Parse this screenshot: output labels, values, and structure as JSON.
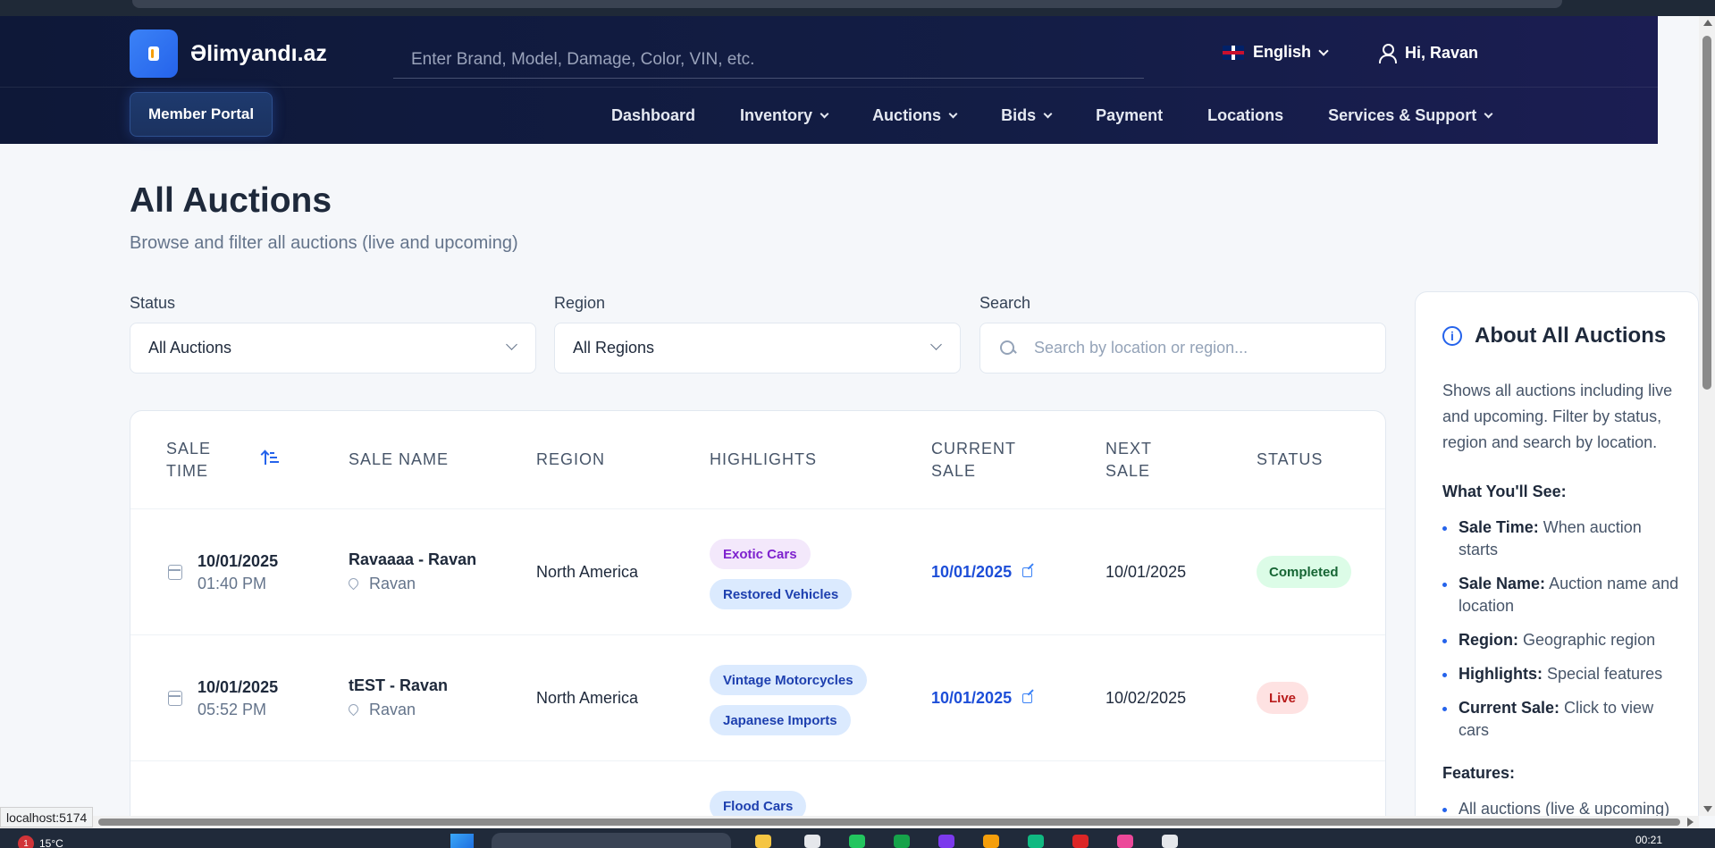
{
  "header": {
    "brand": "Əlimyandı.az",
    "search_placeholder": "Enter Brand, Model, Damage, Color, VIN, etc.",
    "language": "English",
    "greeting": "Hi, Ravan",
    "member_portal": "Member Portal"
  },
  "nav": [
    {
      "label": "Dashboard",
      "has_dropdown": false
    },
    {
      "label": "Inventory",
      "has_dropdown": true
    },
    {
      "label": "Auctions",
      "has_dropdown": true
    },
    {
      "label": "Bids",
      "has_dropdown": true
    },
    {
      "label": "Payment",
      "has_dropdown": false
    },
    {
      "label": "Locations",
      "has_dropdown": false
    },
    {
      "label": "Services & Support",
      "has_dropdown": true
    }
  ],
  "page": {
    "title": "All Auctions",
    "subtitle": "Browse and filter all auctions (live and upcoming)"
  },
  "filters": {
    "status_label": "Status",
    "status_value": "All Auctions",
    "region_label": "Region",
    "region_value": "All Regions",
    "search_label": "Search",
    "search_placeholder": "Search by location or region..."
  },
  "table": {
    "headers": {
      "sale_time": "SALE TIME",
      "sale_name": "SALE NAME",
      "region": "REGION",
      "highlights": "HIGHLIGHTS",
      "current_sale": "CURRENT SALE",
      "next_sale": "NEXT SALE",
      "status": "STATUS"
    },
    "rows": [
      {
        "date": "10/01/2025",
        "time": "01:40 PM",
        "name": "Ravaaaa - Ravan",
        "location": "Ravan",
        "region": "North America",
        "highlights": [
          "Exotic Cars",
          "Restored Vehicles"
        ],
        "current_sale": "10/01/2025",
        "next_sale": "10/01/2025",
        "status": "Completed"
      },
      {
        "date": "10/01/2025",
        "time": "05:52 PM",
        "name": "tEST - Ravan",
        "location": "Ravan",
        "region": "North America",
        "highlights": [
          "Vintage Motorcycles",
          "Japanese Imports"
        ],
        "current_sale": "10/01/2025",
        "next_sale": "10/02/2025",
        "status": "Live"
      },
      {
        "highlights": [
          "Flood Cars"
        ]
      }
    ]
  },
  "info": {
    "title": "About All Auctions",
    "description": "Shows all auctions including live and upcoming. Filter by status, region and search by location.",
    "see_heading": "What You'll See:",
    "items": [
      {
        "term": "Sale Time:",
        "desc": "When auction starts"
      },
      {
        "term": "Sale Name:",
        "desc": "Auction name and location"
      },
      {
        "term": "Region:",
        "desc": "Geographic region"
      },
      {
        "term": "Highlights:",
        "desc": "Special features"
      },
      {
        "term": "Current Sale:",
        "desc": "Click to view cars"
      }
    ],
    "features_heading": "Features:",
    "features": [
      "All auctions (live & upcoming)"
    ]
  },
  "statusbar": {
    "url": "localhost:5174"
  },
  "taskbar": {
    "badge": "1",
    "temp": "15°C",
    "time": "00:21"
  },
  "colors": {
    "header_bg": "#0e1838",
    "accent": "#2563eb",
    "completed": "#166534",
    "live": "#b91c1c"
  }
}
